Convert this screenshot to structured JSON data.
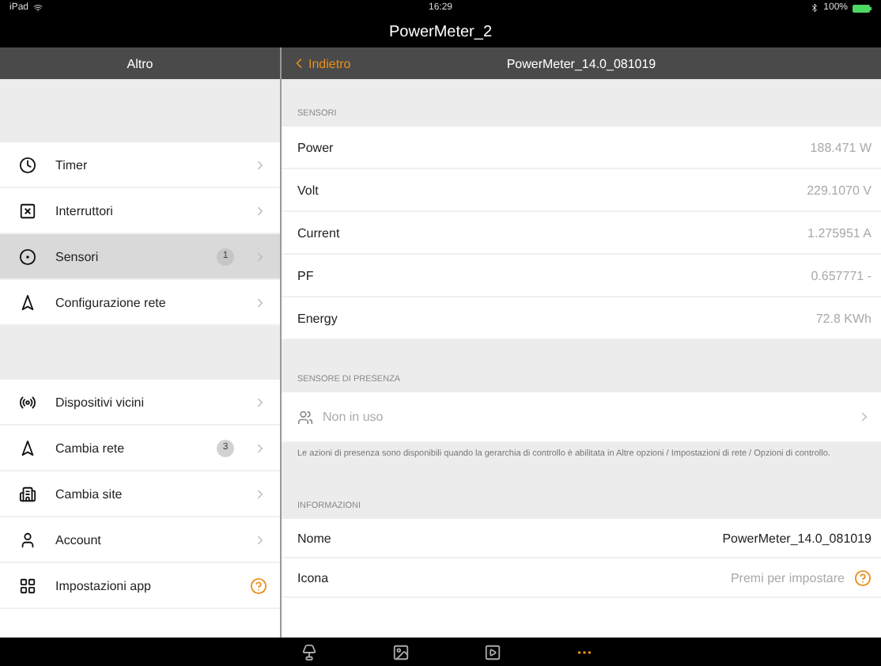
{
  "status_bar": {
    "device": "iPad",
    "time": "16:29",
    "battery": "100%"
  },
  "window": {
    "title": "PowerMeter_2"
  },
  "sidebar": {
    "title": "Altro",
    "groups": [
      {
        "items": [
          {
            "label": "Timer",
            "selected": false,
            "kind": "link"
          },
          {
            "label": "Interruttori",
            "selected": false,
            "kind": "link"
          },
          {
            "label": "Sensori",
            "selected": true,
            "kind": "link",
            "badge": "1"
          },
          {
            "label": "Configurazione rete",
            "selected": false,
            "kind": "link"
          }
        ]
      },
      {
        "items": [
          {
            "label": "Dispositivi vicini",
            "selected": false,
            "kind": "link"
          },
          {
            "label": "Cambia rete",
            "selected": false,
            "kind": "link",
            "badge": "3"
          },
          {
            "label": "Cambia site",
            "selected": false,
            "kind": "link"
          },
          {
            "label": "Account",
            "selected": false,
            "kind": "link"
          },
          {
            "label": "Impostazioni app",
            "selected": false,
            "kind": "help"
          }
        ]
      }
    ]
  },
  "detail": {
    "back": "Indietro",
    "title": "PowerMeter_14.0_081019",
    "sensors": {
      "header": "SENSORI",
      "rows": [
        {
          "label": "Power",
          "value": "188.471 W"
        },
        {
          "label": "Volt",
          "value": "229.1070 V"
        },
        {
          "label": "Current",
          "value": "1.275951 A"
        },
        {
          "label": "PF",
          "value": "0.657771 -"
        },
        {
          "label": "Energy",
          "value": "72.8 KWh"
        }
      ]
    },
    "presence": {
      "header": "SENSORE DI PRESENZA",
      "value": "Non in uso",
      "note": "Le azioni di presenza sono disponibili quando la gerarchia di controllo è abilitata in Altre opzioni / Impostazioni di rete / Opzioni di controllo."
    },
    "info": {
      "header": "INFORMAZIONI",
      "rows": [
        {
          "label": "Nome",
          "value": "PowerMeter_14.0_081019",
          "kind": "plain"
        },
        {
          "label": "Icona",
          "value": "Premi per impostare",
          "kind": "help"
        }
      ]
    }
  },
  "tab_bar": [
    {
      "selected": false
    },
    {
      "selected": false
    },
    {
      "selected": false
    },
    {
      "selected": true
    }
  ]
}
